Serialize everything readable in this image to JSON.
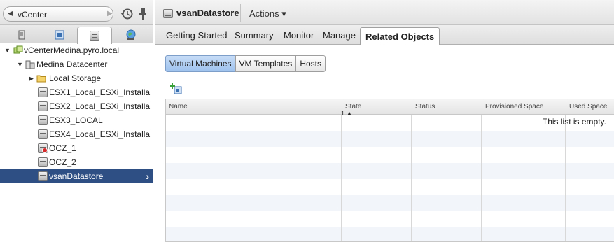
{
  "nav": {
    "breadcrumb": "vCenter"
  },
  "tree": [
    {
      "label": "vCenterMedina.pyro.local",
      "icon": "vcenter-icon",
      "expanded": true
    },
    {
      "label": "Medina Datacenter",
      "icon": "datacenter-icon",
      "expanded": true
    },
    {
      "label": "Local Storage",
      "icon": "folder-icon",
      "expanded": false
    },
    {
      "label": "ESX1_Local_ESXi_Installa",
      "icon": "datastore-icon"
    },
    {
      "label": "ESX2_Local_ESXi_Installa",
      "icon": "datastore-icon"
    },
    {
      "label": "ESX3_LOCAL",
      "icon": "datastore-icon"
    },
    {
      "label": "ESX4_Local_ESXi_Installa",
      "icon": "datastore-icon"
    },
    {
      "label": "OCZ_1",
      "icon": "datastore-alert-icon"
    },
    {
      "label": "OCZ_2",
      "icon": "datastore-icon"
    },
    {
      "label": "vsanDatastore",
      "icon": "datastore-icon",
      "selected": true
    }
  ],
  "header": {
    "title": "vsanDatastore",
    "actions_label": "Actions ▾"
  },
  "tabs": [
    "Getting Started",
    "Summary",
    "Monitor",
    "Manage",
    "Related Objects"
  ],
  "subtabs": [
    "Virtual Machines",
    "VM Templates",
    "Hosts"
  ],
  "grid": {
    "columns": [
      "Name",
      "State",
      "Status",
      "Provisioned Space",
      "Used Space"
    ],
    "sort_indicator": "1 ▲",
    "empty_message": "This list is empty."
  },
  "colors": {
    "selection": "#2e4f84",
    "subtab_selected": "#9ec2ee"
  }
}
